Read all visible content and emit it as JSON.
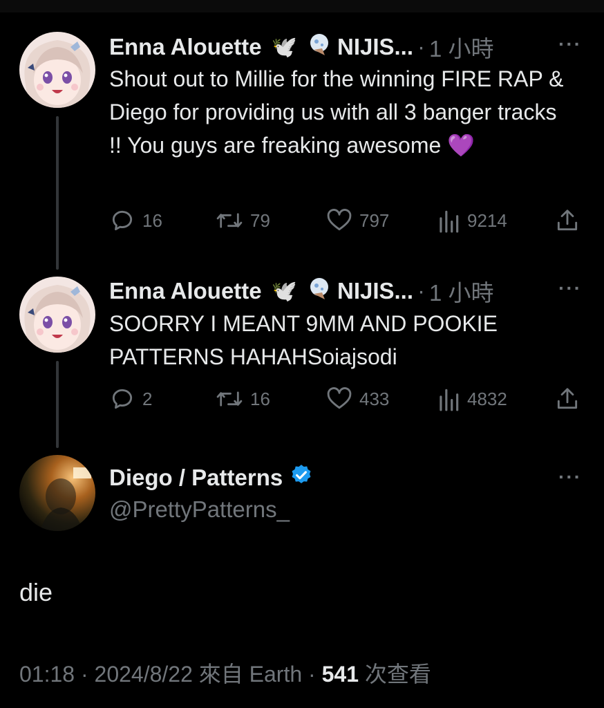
{
  "tweets": [
    {
      "author": "Enna Alouette",
      "affiliation": "NIJIS...",
      "time": "1 小時",
      "text": "Shout out to Millie for the winning FIRE RAP & Diego for providing us with all 3 banger tracks !! You guys are freaking awesome 💜",
      "replies": "16",
      "retweets": "79",
      "likes": "797",
      "views": "9214"
    },
    {
      "author": "Enna Alouette",
      "affiliation": "NIJIS...",
      "time": "1 小時",
      "text": "SOORRY I MEANT 9MM AND POOKIE PATTERNS HAHAHSoiajsodi",
      "replies": "2",
      "retweets": "16",
      "likes": "433",
      "views": "4832"
    }
  ],
  "main": {
    "author": "Diego / Patterns",
    "handle": "@PrettyPatterns_",
    "text": "die",
    "time": "01:18",
    "date": "2024/8/22",
    "source": "來自 Earth",
    "views": "541",
    "views_label": "次查看",
    "sep": "·",
    "more": "···"
  },
  "icons": {
    "dove": "🕊️",
    "moon_glyph": "🌙",
    "verified_color": "#1d9bf0"
  }
}
